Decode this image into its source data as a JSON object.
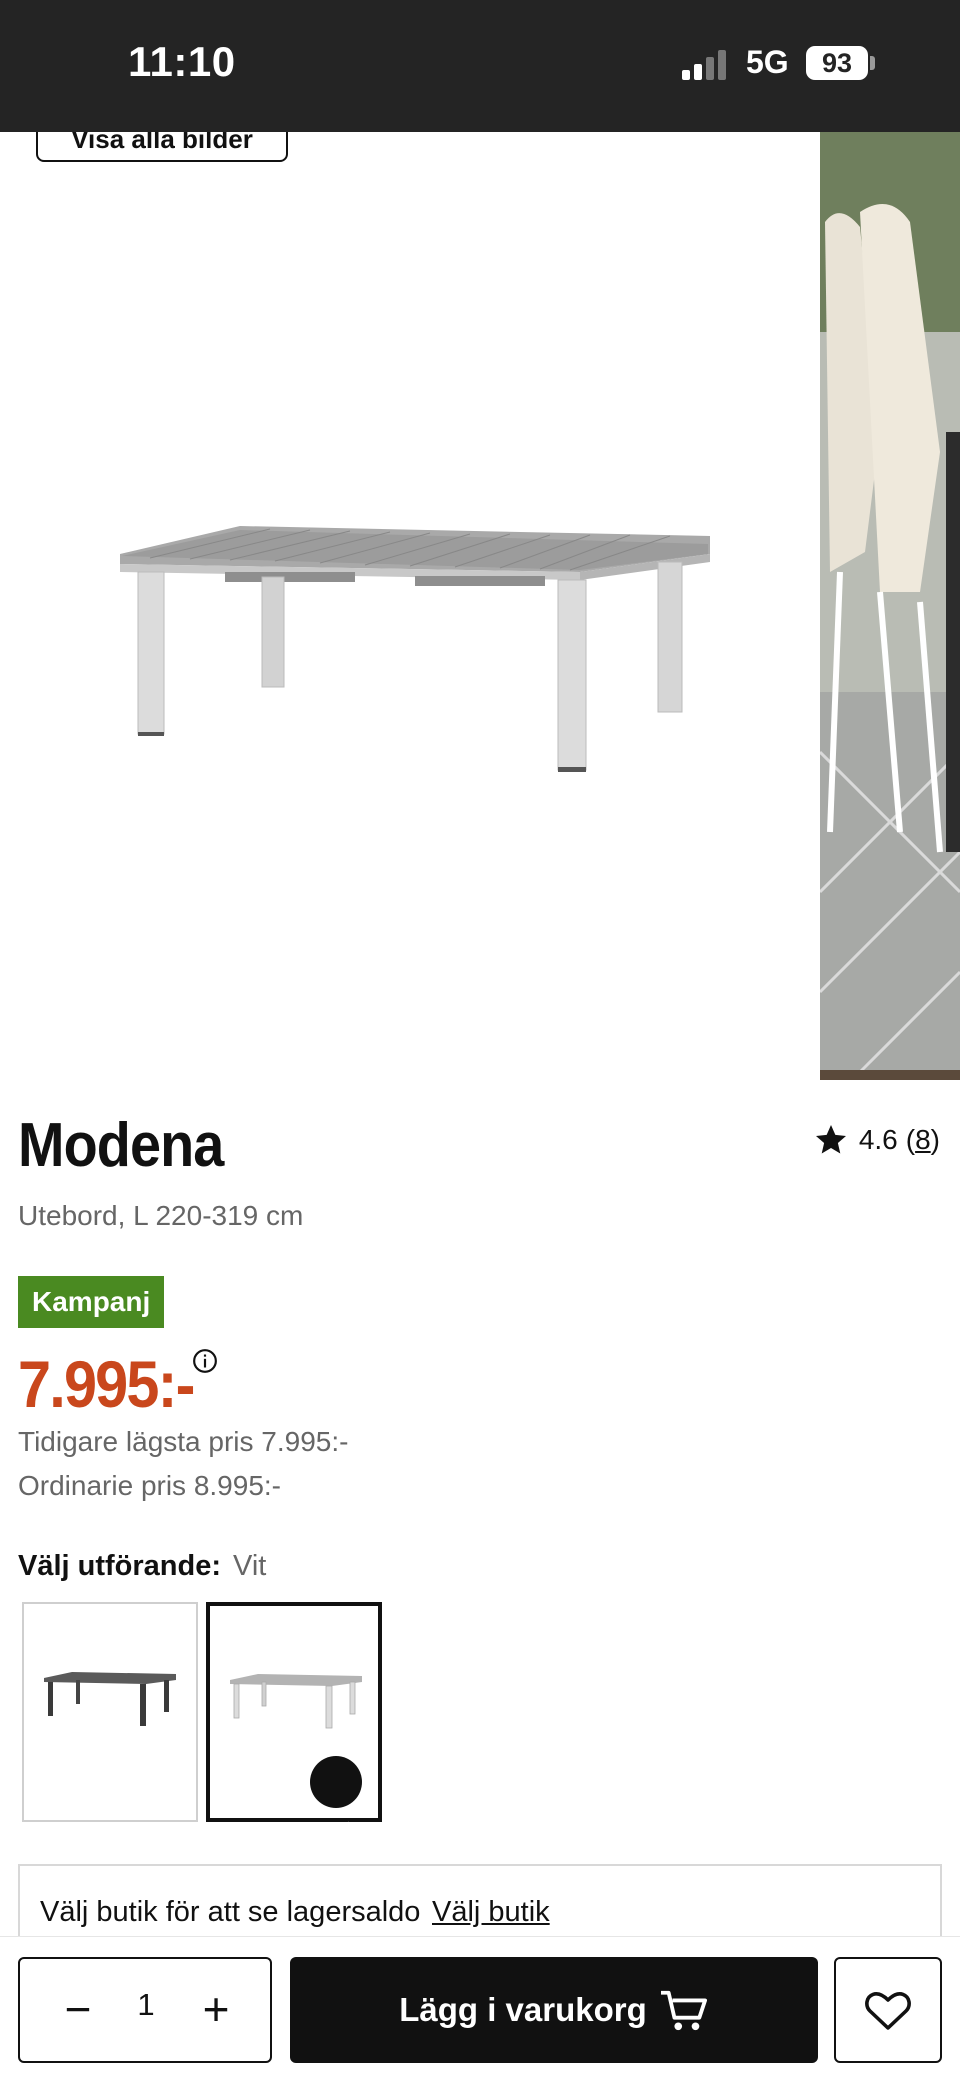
{
  "status_bar": {
    "time": "11:10",
    "network": "5G",
    "battery": "93"
  },
  "gallery": {
    "show_all_label": "Visa alla bilder"
  },
  "product": {
    "name": "Modena",
    "subtitle": "Utebord, L 220-319 cm",
    "rating": "4.6",
    "rating_count": "8",
    "badge": "Kampanj",
    "price": "7.995:-",
    "previous_lowest": "Tidigare lägsta pris 7.995:-",
    "ordinary": "Ordinarie pris 8.995:-"
  },
  "variant": {
    "label": "Välj utförande:",
    "selected": "Vit",
    "options": [
      "dark-table",
      "white-table"
    ]
  },
  "store": {
    "text": "Välj butik för att se lagersaldo",
    "link": "Välj butik"
  },
  "cart": {
    "quantity": "1",
    "add_label": "Lägg i varukorg"
  },
  "colors": {
    "campaign": "#4a8a21",
    "price": "#c9471c",
    "status_bar": "#242424"
  }
}
